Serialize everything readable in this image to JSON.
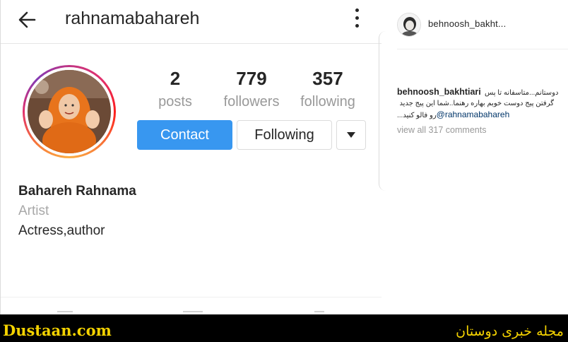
{
  "header": {
    "username": "rahnamabahareh",
    "back_icon": "arrow-left-icon",
    "menu_icon": "more-vertical-icon"
  },
  "profile": {
    "stats": [
      {
        "value": "2",
        "label": "posts"
      },
      {
        "value": "779",
        "label": "followers"
      },
      {
        "value": "357",
        "label": "following"
      }
    ],
    "contact_label": "Contact",
    "following_label": "Following",
    "dropdown_icon": "caret-down-icon",
    "name": "Bahareh Rahnama",
    "category": "Artist",
    "bio": "Actress,author"
  },
  "comment_panel": {
    "post_author": "behnoosh_bakht...",
    "comment": {
      "user": "behnoosh_bakhtiari",
      "line1": "دوستانم...متاسفانه تا پس",
      "line2": "گرفتن پیج دوست خوبم بهاره رهنما..شما این پیج جدید",
      "mention": "@rahnamabahareh",
      "line3_suffix": "...رو فالو کنید"
    },
    "view_all": "view all 317 comments"
  },
  "footer": {
    "site_name": "Dustaan.com",
    "site_tagline": "مجله خبری دوستان"
  },
  "colors": {
    "accent_blue": "#3897f0",
    "muted_text": "#999999",
    "banner_bg": "#000000",
    "banner_text": "#f5d300"
  }
}
